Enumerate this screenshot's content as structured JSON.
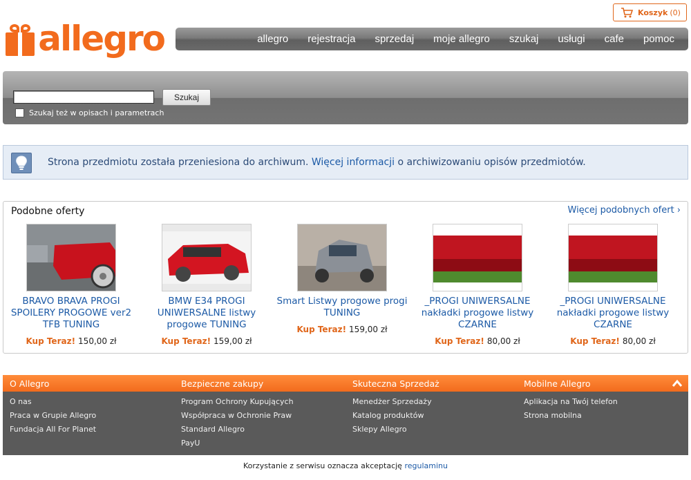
{
  "header": {
    "logo_text": "allegro",
    "cart_label": "Koszyk",
    "cart_count": "(0)",
    "nav": [
      "allegro",
      "rejestracja",
      "sprzedaj",
      "moje allegro",
      "szukaj",
      "usługi",
      "cafe",
      "pomoc"
    ]
  },
  "search": {
    "input_value": "",
    "button_label": "Szukaj",
    "checkbox_label": "Szukaj też w opisach i parametrach",
    "checkbox_checked": false
  },
  "info": {
    "text_before": "Strona przedmiotu została przeniesiona do archiwum. ",
    "link_text": "Więcej informacji",
    "text_after": " o archiwizowaniu opisów przedmiotów."
  },
  "similar": {
    "title": "Podobne oferty",
    "more_link": "Więcej podobnych ofert ›",
    "offers": [
      {
        "name": "BRAVO BRAVA PROGI SPOILERY PROGOWE ver2 TFB TUNING",
        "kup_label": "Kup Teraz!",
        "price": "150,00 zł"
      },
      {
        "name": "BMW E34 PROGI UNIWERSALNE listwy progowe TUNING",
        "kup_label": "Kup Teraz!",
        "price": "159,00 zł"
      },
      {
        "name": "Smart Listwy progowe progi TUNING",
        "kup_label": "Kup Teraz!",
        "price": "159,00 zł"
      },
      {
        "name": "_PROGI UNIWERSALNE nakładki progowe listwy CZARNE",
        "kup_label": "Kup Teraz!",
        "price": "80,00 zł"
      },
      {
        "name": "_PROGI UNIWERSALNE nakładki progowe listwy CZARNE",
        "kup_label": "Kup Teraz!",
        "price": "80,00 zł"
      }
    ]
  },
  "footer": {
    "columns": [
      {
        "title": "O Allegro",
        "links": [
          "O nas",
          "Praca w Grupie Allegro",
          "Fundacja All For Planet"
        ]
      },
      {
        "title": "Bezpieczne zakupy",
        "links": [
          "Program Ochrony Kupujących",
          "Współpraca w Ochronie Praw",
          "Standard Allegro",
          "PayU"
        ]
      },
      {
        "title": "Skuteczna Sprzedaż",
        "links": [
          "Menedżer Sprzedaży",
          "Katalog produktów",
          "Sklepy Allegro"
        ]
      },
      {
        "title": "Mobilne Allegro",
        "links": [
          "Aplikacja na Twój telefon",
          "Strona mobilna"
        ]
      }
    ],
    "legal_text": "Korzystanie z serwisu oznacza akceptację ",
    "legal_link": "regulaminu"
  },
  "colors": {
    "brand": "#f26b1d",
    "link": "#1c5aa6"
  }
}
